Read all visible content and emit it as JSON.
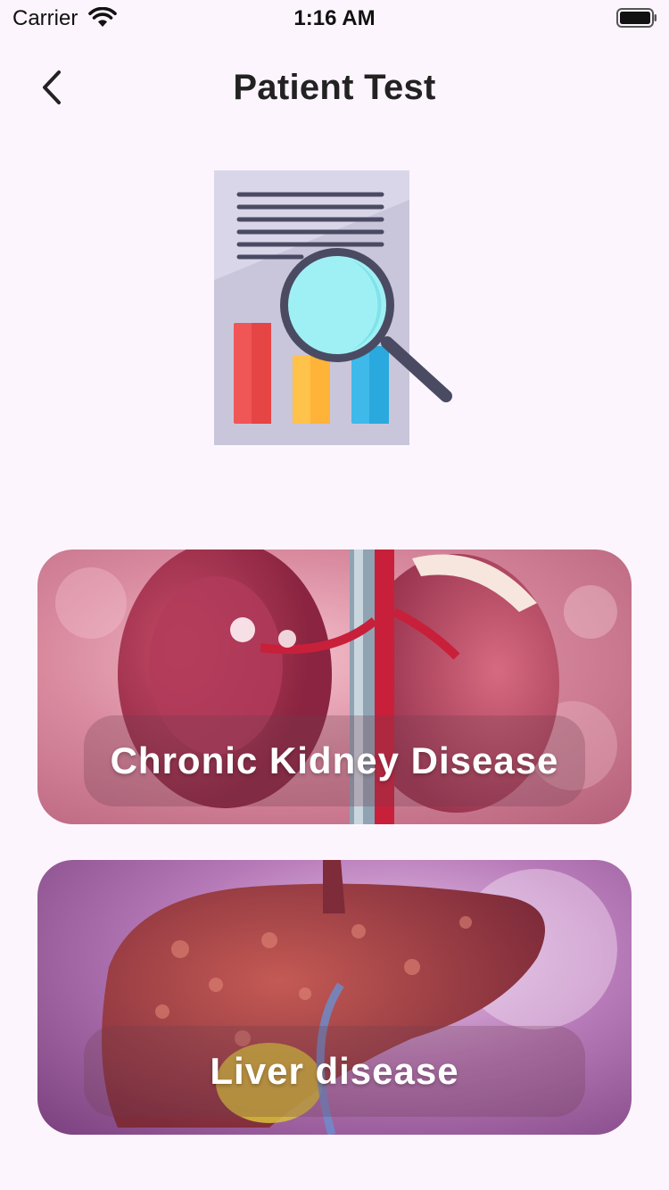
{
  "status_bar": {
    "carrier": "Carrier",
    "time": "1:16 AM"
  },
  "nav": {
    "title": "Patient Test"
  },
  "cards": [
    {
      "label": "Chronic Kidney Disease"
    },
    {
      "label": "Liver disease"
    }
  ],
  "icons": {
    "back": "chevron-left-icon",
    "wifi": "wifi-icon",
    "battery": "battery-icon",
    "hero": "test-report-magnifier-icon"
  },
  "colors": {
    "background": "#fdf5fd",
    "text": "#222222",
    "label": "#ffffff"
  }
}
